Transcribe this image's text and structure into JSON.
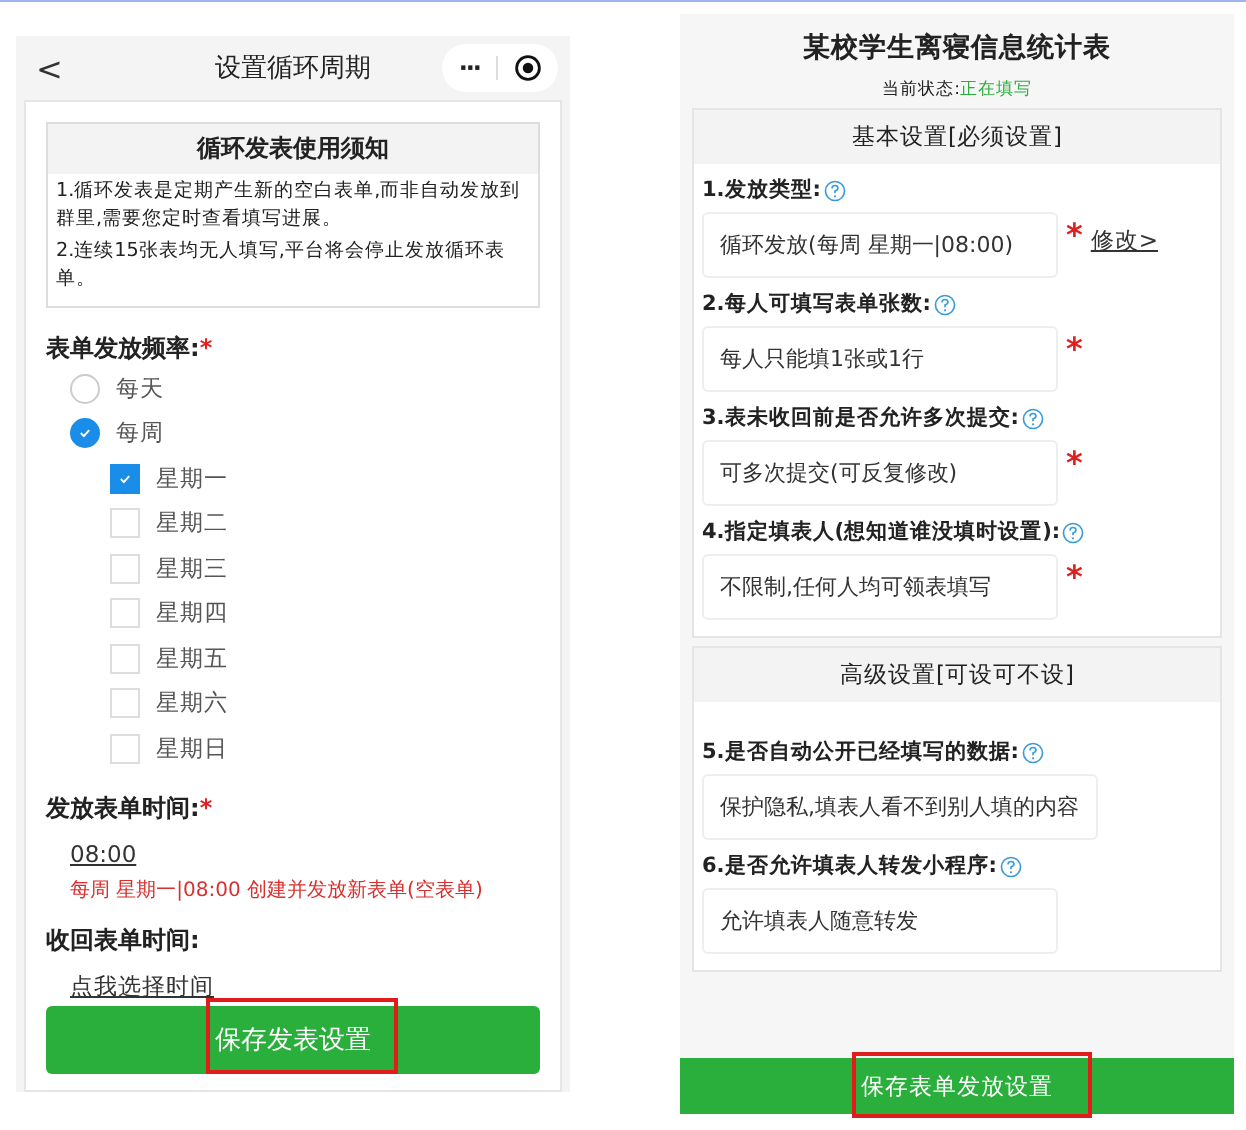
{
  "left": {
    "nav": {
      "back": "<",
      "title": "设置循环周期",
      "more": "···"
    },
    "notice": {
      "title": "循环发表使用须知",
      "lines": [
        "1.循环发表是定期产生新的空白表单,而非自动发放到群里,需要您定时查看填写进展。",
        "2.连续15张表均无人填写,平台将会停止发放循环表单。"
      ]
    },
    "frequency": {
      "label": "表单发放频率:",
      "required_mark": "*",
      "options": [
        {
          "label": "每天",
          "selected": false
        },
        {
          "label": "每周",
          "selected": true
        }
      ],
      "days": [
        {
          "label": "星期一",
          "checked": true
        },
        {
          "label": "星期二",
          "checked": false
        },
        {
          "label": "星期三",
          "checked": false
        },
        {
          "label": "星期四",
          "checked": false
        },
        {
          "label": "星期五",
          "checked": false
        },
        {
          "label": "星期六",
          "checked": false
        },
        {
          "label": "星期日",
          "checked": false
        }
      ]
    },
    "send_time": {
      "label": "发放表单时间:",
      "required_mark": "*",
      "value": "08:00",
      "hint": "每周 星期一|08:00 创建并发放新表单(空表单)"
    },
    "collect_time": {
      "label": "收回表单时间:",
      "link": "点我选择时间"
    },
    "save_button": "保存发表设置"
  },
  "right": {
    "title": "某校学生离寝信息统计表",
    "status_label": "当前状态:",
    "status": "正在填写",
    "sections": [
      {
        "title": "基本设置[必须设置]",
        "fields": [
          {
            "label": "1.发放类型:",
            "value": "循环发放(每周 星期一|08:00)",
            "required_mark": "*",
            "link": "修改>"
          },
          {
            "label": "2.每人可填写表单张数:",
            "value": "每人只能填1张或1行",
            "required_mark": "*"
          },
          {
            "label": "3.表未收回前是否允许多次提交:",
            "value": "可多次提交(可反复修改)",
            "required_mark": "*"
          },
          {
            "label": "4.指定填表人(想知道谁没填时设置):",
            "value": "不限制,任何人均可领表填写",
            "required_mark": "*"
          }
        ]
      },
      {
        "title": "高级设置[可设可不设]",
        "fields": [
          {
            "label": "5.是否自动公开已经填写的数据:",
            "value": "保护隐私,填表人看不到别人填的内容"
          },
          {
            "label": "6.是否允许填表人转发小程序:",
            "value": "允许填表人随意转发"
          }
        ]
      }
    ],
    "save_button": "保存表单发放设置"
  }
}
